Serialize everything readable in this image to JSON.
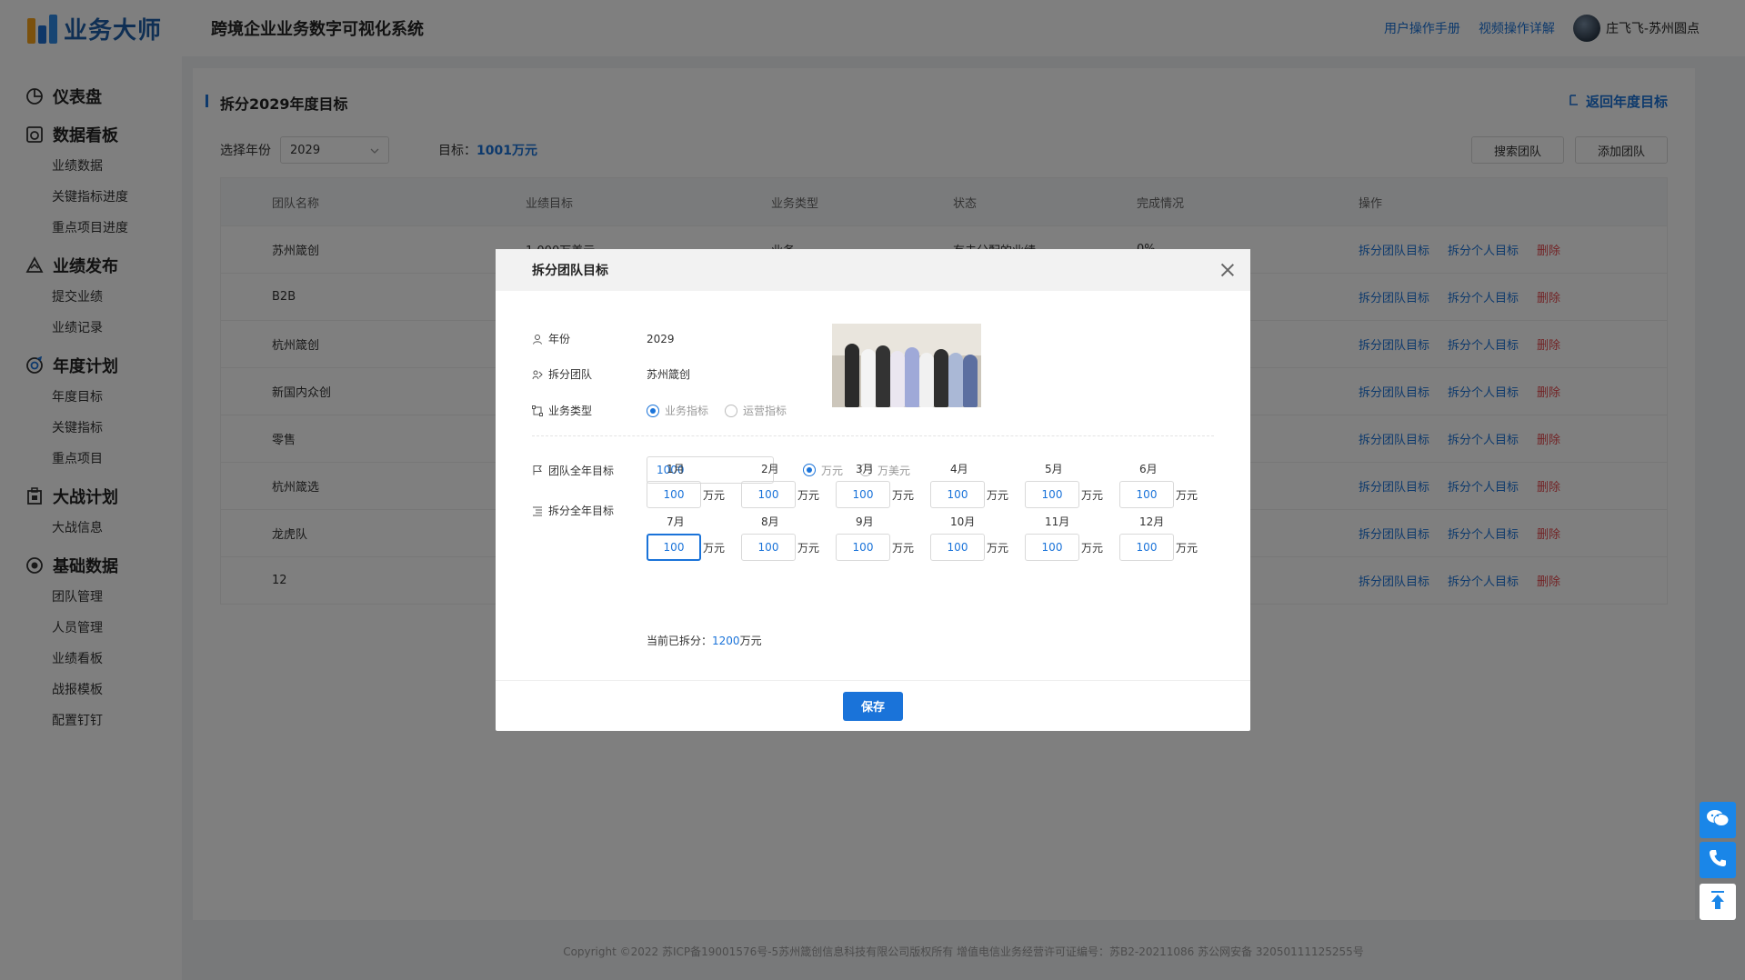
{
  "app": {
    "logo_text": "业务大师",
    "system_title": "跨境企业业务数字可视化系统"
  },
  "header": {
    "manual_link": "用户操作手册",
    "video_link": "视频操作详解",
    "user_name": "庄飞飞-苏州圆点"
  },
  "sidebar": {
    "groups": [
      {
        "label": "仪表盘",
        "icon": "pie-chart-icon",
        "items": []
      },
      {
        "label": "数据看板",
        "icon": "dashboard-icon",
        "items": [
          "业绩数据",
          "关键指标进度",
          "重点项目进度"
        ]
      },
      {
        "label": "业绩发布",
        "icon": "warning-triangle-icon",
        "items": [
          "提交业绩",
          "业绩记录"
        ]
      },
      {
        "label": "年度计划",
        "icon": "target-icon",
        "items": [
          "年度目标",
          "关键指标",
          "重点项目"
        ]
      },
      {
        "label": "大战计划",
        "icon": "building-icon",
        "items": [
          "大战信息"
        ]
      },
      {
        "label": "基础数据",
        "icon": "settings-circle-icon",
        "items": [
          "团队管理",
          "人员管理",
          "业绩看板",
          "战报模板",
          "配置钉钉"
        ]
      }
    ]
  },
  "page": {
    "title": "拆分2029年度目标",
    "back_link": "返回年度目标",
    "year_label": "选择年份",
    "year_value": "2029",
    "goal_label": "目标：",
    "goal_value": "1001万元",
    "search_team_button": "搜索团队",
    "add_team_button": "添加团队"
  },
  "table": {
    "headers": [
      "团队名称",
      "业绩目标",
      "业务类型",
      "状态",
      "完成情况",
      "操作"
    ],
    "rows": [
      {
        "name": "苏州箴创",
        "target": "1,000万美元",
        "type": "业务",
        "status": "有未分配的业绩",
        "progress": "0%"
      },
      {
        "name": "B2B",
        "target": "",
        "type": "",
        "status": "",
        "progress": ""
      },
      {
        "name": "杭州箴创",
        "target": "",
        "type": "",
        "status": "",
        "progress": ""
      },
      {
        "name": "新国内众创",
        "target": "",
        "type": "",
        "status": "",
        "progress": ""
      },
      {
        "name": "零售",
        "target": "",
        "type": "",
        "status": "",
        "progress": ""
      },
      {
        "name": "杭州箴选",
        "target": "",
        "type": "",
        "status": "",
        "progress": ""
      },
      {
        "name": "龙虎队",
        "target": "",
        "type": "",
        "status": "",
        "progress": ""
      },
      {
        "name": "12",
        "target": "",
        "type": "",
        "status": "",
        "progress": ""
      }
    ],
    "op_split_team": "拆分团队目标",
    "op_split_personal": "拆分个人目标",
    "op_delete": "删除"
  },
  "footer": {
    "copyright": "Copyright ©2022 苏ICP备19001576号-5苏州箴创信息科技有限公司版权所有    增值电信业务经营许可证编号：苏B2-20211086 苏公网安备 32050111125255号"
  },
  "modal": {
    "title": "拆分团队目标",
    "year_label": "年份",
    "year_value": "2029",
    "team_label": "拆分团队",
    "team_value": "苏州箴创",
    "type_label": "业务类型",
    "type_options": [
      "业务指标",
      "运营指标"
    ],
    "type_selected": 0,
    "annual_label": "团队全年目标",
    "annual_value": "1000",
    "unit_options": [
      "万元",
      "万美元"
    ],
    "unit_selected": 0,
    "split_label": "拆分全年目标",
    "months": [
      {
        "label": "1月",
        "value": "100"
      },
      {
        "label": "2月",
        "value": "100"
      },
      {
        "label": "3月",
        "value": "100"
      },
      {
        "label": "4月",
        "value": "100"
      },
      {
        "label": "5月",
        "value": "100"
      },
      {
        "label": "6月",
        "value": "100"
      },
      {
        "label": "7月",
        "value": "100"
      },
      {
        "label": "8月",
        "value": "100"
      },
      {
        "label": "9月",
        "value": "100"
      },
      {
        "label": "10月",
        "value": "100"
      },
      {
        "label": "11月",
        "value": "100"
      },
      {
        "label": "12月",
        "value": "100"
      }
    ],
    "month_unit": "万元",
    "split_now_label": "当前已拆分：",
    "split_now_value": "1200",
    "split_now_unit": "万元",
    "save_button": "保存"
  },
  "colors": {
    "accent": "#1a73d9",
    "danger": "#e5484d",
    "float_blue": "#1a86e8"
  }
}
